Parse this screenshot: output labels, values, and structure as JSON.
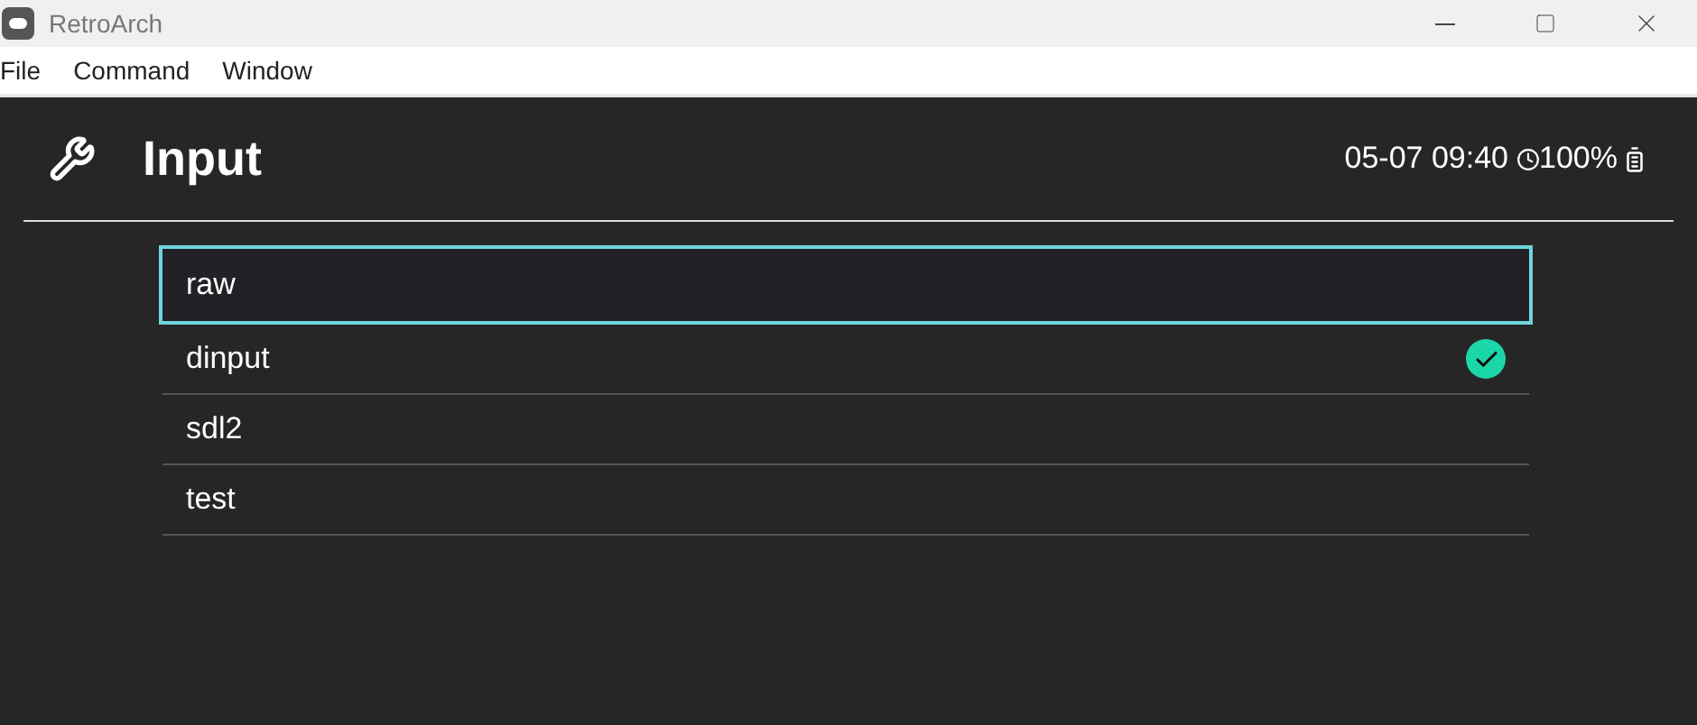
{
  "window": {
    "title": "RetroArch"
  },
  "menu": [
    "File",
    "Command",
    "Window"
  ],
  "header": {
    "title": "Input",
    "datetime": "05-07 09:40",
    "battery": "100%"
  },
  "items": [
    {
      "label": "raw",
      "selected": true,
      "checked": false
    },
    {
      "label": "dinput",
      "selected": false,
      "checked": true
    },
    {
      "label": "sdl2",
      "selected": false,
      "checked": false
    },
    {
      "label": "test",
      "selected": false,
      "checked": false
    }
  ]
}
